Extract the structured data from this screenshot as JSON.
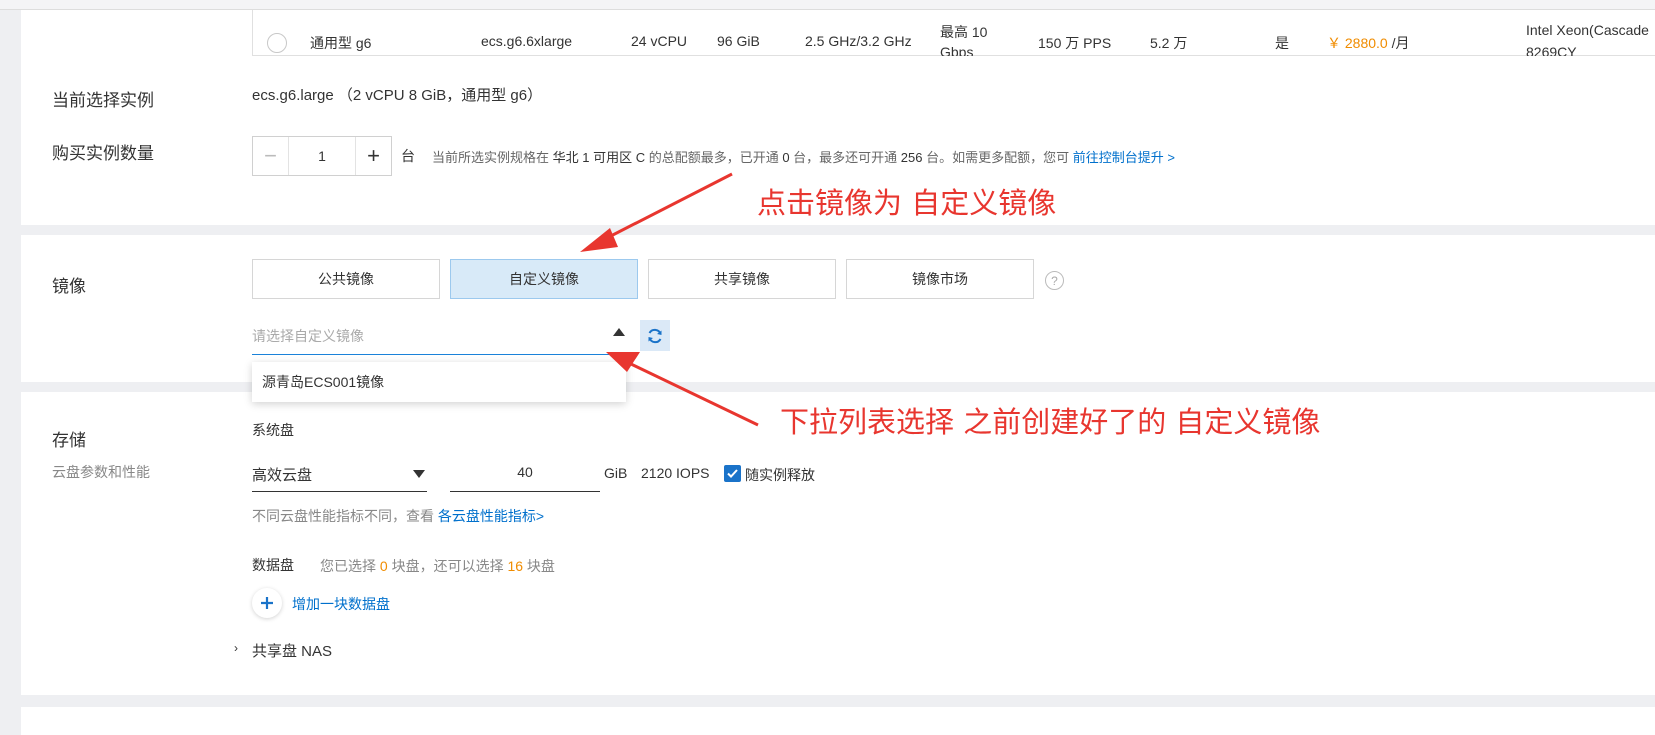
{
  "table_row": {
    "type": "通用型 g6",
    "spec": "ecs.g6.6xlarge",
    "vcpu": "24 vCPU",
    "memory": "96 GiB",
    "freq": "2.5 GHz/3.2 GHz",
    "bandwidth_l1": "最高 10",
    "bandwidth_l2": "Gbps",
    "pps": "150 万 PPS",
    "connections": "5.2 万",
    "ipv6": "是",
    "price": "￥ 2880.0",
    "price_unit": " /月",
    "cpu_l1": "Intel Xeon(Cascade",
    "cpu_l2": "8269CY"
  },
  "current_instance": {
    "label": "当前选择实例",
    "value": "ecs.g6.large （2 vCPU 8 GiB，通用型 g6）"
  },
  "quantity": {
    "label": "购买实例数量",
    "minus": "−",
    "value": "1",
    "plus": "+",
    "unit": "台",
    "note_pre": "当前所选实例规格在 ",
    "note_zone": "华北 1 可用区 C",
    "note_mid1": " 的总配额最多，已开通 ",
    "note_opened": "0",
    "note_mid2": " 台，最多还可开通 ",
    "note_max": "256",
    "note_post": " 台。如需更多配额，您可 ",
    "note_link": "前往控制台提升 >"
  },
  "image": {
    "label": "镜像",
    "tabs": [
      "公共镜像",
      "自定义镜像",
      "共享镜像",
      "镜像市场"
    ],
    "select_placeholder": "请选择自定义镜像",
    "dropdown_option": "源青岛ECS001镜像"
  },
  "storage": {
    "label": "存储",
    "sublabel": "云盘参数和性能",
    "system_disk_label": "系统盘",
    "disk_type": "高效云盘",
    "disk_size": "40",
    "disk_unit": "GiB",
    "iops": "2120 IOPS",
    "release_label": "随实例释放",
    "perf_note": "不同云盘性能指标不同，查看 ",
    "perf_link": "各云盘性能指标>",
    "data_disk_label": "数据盘",
    "data_note_1": "您已选择 ",
    "data_selected": "0",
    "data_note_2": " 块盘，还可以选择 ",
    "data_remaining": "16",
    "data_note_3": " 块盘",
    "add_disk": "增加一块数据盘",
    "nas": "共享盘 NAS"
  },
  "annotations": {
    "first": "点击镜像为 自定义镜像",
    "second": "下拉列表选择 之前创建好了的 自定义镜像"
  },
  "colors": {
    "accent": "#0070cc",
    "annotation": "#e8362f",
    "price": "#f08c00",
    "active_tab_bg": "#d8eaf8"
  }
}
